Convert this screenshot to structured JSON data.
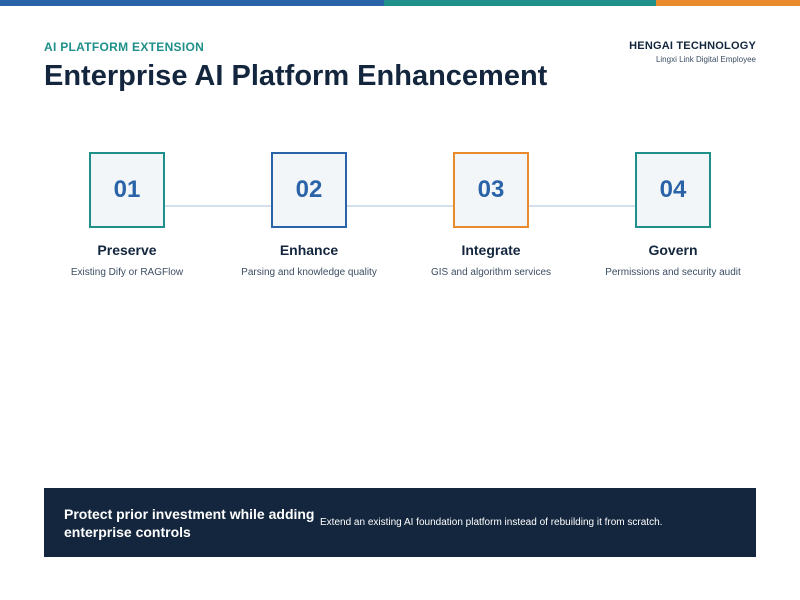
{
  "colors": {
    "navy": "#13263d",
    "blue": "#2b63a8",
    "teal": "#1f8f8a",
    "orange": "#e98b2c"
  },
  "header": {
    "eyebrow": "AI PLATFORM EXTENSION",
    "title": "Enterprise AI Platform Enhancement",
    "brand_name": "HENGAI TECHNOLOGY",
    "brand_sub": "Lingxi Link Digital Employee"
  },
  "steps": [
    {
      "number": "01",
      "label": "Preserve",
      "desc": "Existing Dify or RAGFlow"
    },
    {
      "number": "02",
      "label": "Enhance",
      "desc": "Parsing and knowledge quality"
    },
    {
      "number": "03",
      "label": "Integrate",
      "desc": "GIS and algorithm services"
    },
    {
      "number": "04",
      "label": "Govern",
      "desc": "Permissions and security audit"
    }
  ],
  "banner": {
    "headline": "Protect prior investment while adding enterprise controls",
    "text": "Extend an existing AI foundation platform instead of rebuilding it from scratch."
  }
}
